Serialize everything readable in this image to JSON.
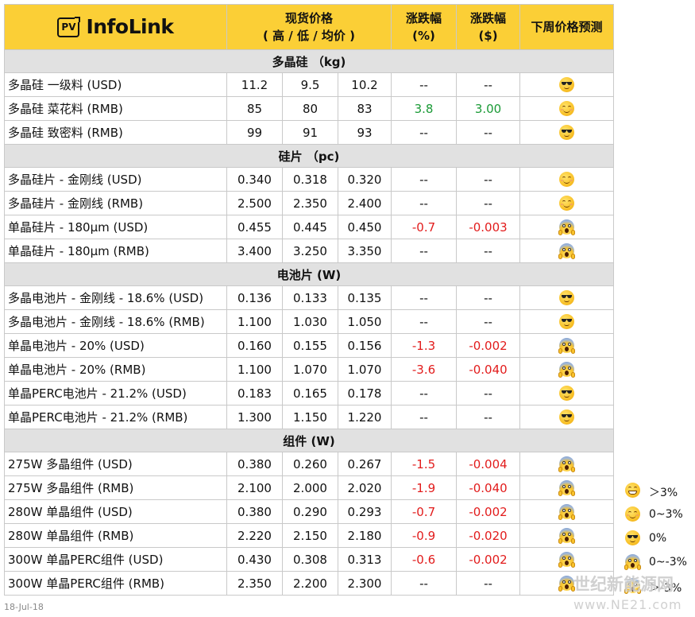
{
  "header": {
    "logo_badge": "PV",
    "logo_text": "InfoLink",
    "spot_price_line1": "现货价格",
    "spot_price_line2": "( 高 / 低 / 均价 )",
    "change_pct_line1": "涨跌幅",
    "change_pct_line2": "(%)",
    "change_abs_line1": "涨跌幅",
    "change_abs_line2": "($)",
    "forecast": "下周价格预测"
  },
  "sections": [
    {
      "title": "多晶硅 （kg)",
      "rows": [
        {
          "name": "多晶硅 一级料 (USD)",
          "high": "11.2",
          "low": "9.5",
          "avg": "10.2",
          "pct": "--",
          "abs": "--",
          "trend": "flat",
          "forecast": "sunglasses-icon"
        },
        {
          "name": "多晶硅 菜花料 (RMB)",
          "high": "85",
          "low": "80",
          "avg": "83",
          "pct": "3.8",
          "abs": "3.00",
          "trend": "up",
          "forecast": "smile-icon"
        },
        {
          "name": "多晶硅 致密料 (RMB)",
          "high": "99",
          "low": "91",
          "avg": "93",
          "pct": "--",
          "abs": "--",
          "trend": "flat",
          "forecast": "sunglasses-icon"
        }
      ]
    },
    {
      "title": "硅片 （pc)",
      "rows": [
        {
          "name": "多晶硅片 - 金刚线 (USD)",
          "high": "0.340",
          "low": "0.318",
          "avg": "0.320",
          "pct": "--",
          "abs": "--",
          "trend": "flat",
          "forecast": "smile-icon"
        },
        {
          "name": "多晶硅片 - 金刚线 (RMB)",
          "high": "2.500",
          "low": "2.350",
          "avg": "2.400",
          "pct": "--",
          "abs": "--",
          "trend": "flat",
          "forecast": "smile-icon"
        },
        {
          "name": "单晶硅片 - 180μm (USD)",
          "high": "0.455",
          "low": "0.445",
          "avg": "0.450",
          "pct": "-0.7",
          "abs": "-0.003",
          "trend": "down",
          "forecast": "scream-icon"
        },
        {
          "name": "单晶硅片 - 180μm (RMB)",
          "high": "3.400",
          "low": "3.250",
          "avg": "3.350",
          "pct": "--",
          "abs": "--",
          "trend": "flat",
          "forecast": "scream-icon"
        }
      ]
    },
    {
      "title": "电池片 (W)",
      "rows": [
        {
          "name": "多晶电池片 - 金刚线 - 18.6% (USD)",
          "high": "0.136",
          "low": "0.133",
          "avg": "0.135",
          "pct": "--",
          "abs": "--",
          "trend": "flat",
          "forecast": "sunglasses-icon"
        },
        {
          "name": "多晶电池片 - 金刚线 - 18.6% (RMB)",
          "high": "1.100",
          "low": "1.030",
          "avg": "1.050",
          "pct": "--",
          "abs": "--",
          "trend": "flat",
          "forecast": "sunglasses-icon"
        },
        {
          "name": "单晶电池片 - 20% (USD)",
          "high": "0.160",
          "low": "0.155",
          "avg": "0.156",
          "pct": "-1.3",
          "abs": "-0.002",
          "trend": "down",
          "forecast": "scream-icon"
        },
        {
          "name": "单晶电池片 - 20% (RMB)",
          "high": "1.100",
          "low": "1.070",
          "avg": "1.070",
          "pct": "-3.6",
          "abs": "-0.040",
          "trend": "down",
          "forecast": "scream-icon"
        },
        {
          "name": "单晶PERC电池片 - 21.2% (USD)",
          "high": "0.183",
          "low": "0.165",
          "avg": "0.178",
          "pct": "--",
          "abs": "--",
          "trend": "flat",
          "forecast": "sunglasses-icon"
        },
        {
          "name": "单晶PERC电池片 - 21.2% (RMB)",
          "high": "1.300",
          "low": "1.150",
          "avg": "1.220",
          "pct": "--",
          "abs": "--",
          "trend": "flat",
          "forecast": "sunglasses-icon"
        }
      ]
    },
    {
      "title": "组件 (W)",
      "rows": [
        {
          "name": "275W 多晶组件 (USD)",
          "high": "0.380",
          "low": "0.260",
          "avg": "0.267",
          "pct": "-1.5",
          "abs": "-0.004",
          "trend": "down",
          "forecast": "scream-icon"
        },
        {
          "name": "275W 多晶组件 (RMB)",
          "high": "2.100",
          "low": "2.000",
          "avg": "2.020",
          "pct": "-1.9",
          "abs": "-0.040",
          "trend": "down",
          "forecast": "scream-icon"
        },
        {
          "name": "280W 单晶组件 (USD)",
          "high": "0.380",
          "low": "0.290",
          "avg": "0.293",
          "pct": "-0.7",
          "abs": "-0.002",
          "trend": "down",
          "forecast": "scream-icon"
        },
        {
          "name": "280W 单晶组件 (RMB)",
          "high": "2.220",
          "low": "2.150",
          "avg": "2.180",
          "pct": "-0.9",
          "abs": "-0.020",
          "trend": "down",
          "forecast": "scream-icon"
        },
        {
          "name": "300W 单晶PERC组件 (USD)",
          "high": "0.430",
          "low": "0.308",
          "avg": "0.313",
          "pct": "-0.6",
          "abs": "-0.002",
          "trend": "down",
          "forecast": "scream-icon"
        },
        {
          "name": "300W 单晶PERC组件 (RMB)",
          "high": "2.350",
          "low": "2.200",
          "avg": "2.300",
          "pct": "--",
          "abs": "--",
          "trend": "flat",
          "forecast": "scream-icon"
        }
      ]
    }
  ],
  "legend": [
    {
      "icon": "grin-icon",
      "label": "＞3%"
    },
    {
      "icon": "smile-icon",
      "label": "0~3%"
    },
    {
      "icon": "sunglasses-icon",
      "label": "0%"
    },
    {
      "icon": "scream-icon",
      "label": "0~-3%"
    },
    {
      "icon": "scream-icon",
      "label": "＞-3%"
    }
  ],
  "colors": {
    "header_bg": "#fbcf36",
    "section_bg": "#e1e1e1",
    "up": "#1a9a36",
    "down": "#e21c1c"
  },
  "footer_date": "18-Jul-18",
  "watermark": {
    "line1": "世纪新能源网",
    "line2": "www.NE21.com"
  }
}
